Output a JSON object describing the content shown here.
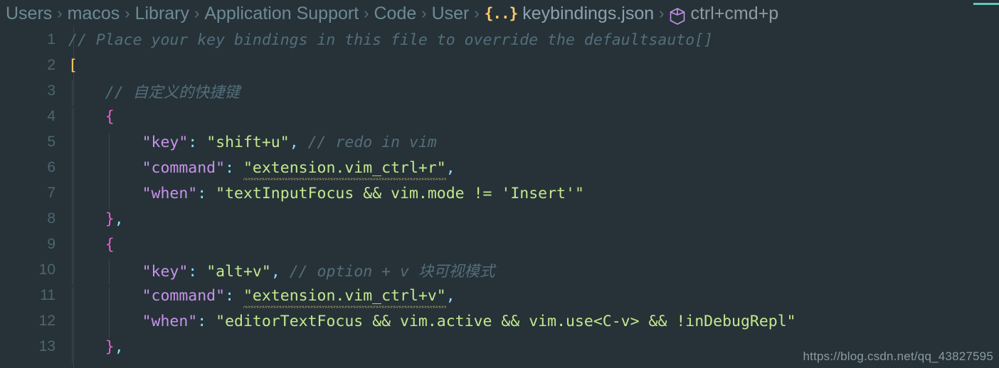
{
  "accent_color": "#5fc9bf",
  "breadcrumb": {
    "segments": [
      {
        "label": "Users",
        "type": "folder"
      },
      {
        "label": "macos",
        "type": "folder"
      },
      {
        "label": "Library",
        "type": "folder"
      },
      {
        "label": "Application Support",
        "type": "folder"
      },
      {
        "label": "Code",
        "type": "folder"
      },
      {
        "label": "User",
        "type": "folder"
      },
      {
        "label": "keybindings.json",
        "type": "file",
        "icon": "json-braces-icon",
        "icon_text": "{..}"
      },
      {
        "label": "ctrl+cmd+p",
        "type": "symbol",
        "icon": "symbol-cube-icon"
      }
    ],
    "separator": "›"
  },
  "editor": {
    "language": "jsonc",
    "file_name": "keybindings.json",
    "lines": [
      {
        "no": "1",
        "text": "// Place your key bindings in this file to override the defaultsauto[]"
      },
      {
        "no": "2",
        "text": "["
      },
      {
        "no": "3",
        "text": "    // 自定义的快捷键"
      },
      {
        "no": "4",
        "text": "    {"
      },
      {
        "no": "5",
        "text": "        \"key\": \"shift+u\", // redo in vim"
      },
      {
        "no": "6",
        "text": "        \"command\": \"extension.vim_ctrl+r\","
      },
      {
        "no": "7",
        "text": "        \"when\": \"textInputFocus && vim.mode != 'Insert'\""
      },
      {
        "no": "8",
        "text": "    },"
      },
      {
        "no": "9",
        "text": "    {"
      },
      {
        "no": "10",
        "text": "        \"key\": \"alt+v\", // option + v 块可视模式"
      },
      {
        "no": "11",
        "text": "        \"command\": \"extension.vim_ctrl+v\","
      },
      {
        "no": "12",
        "text": "        \"when\": \"editorTextFocus && vim.active && vim.use<C-v> && !inDebugRepl\""
      },
      {
        "no": "13",
        "text": "    },"
      }
    ],
    "tokens": {
      "line1_comment": "// Place your key bindings in this file to override the defaultsauto[]",
      "line2_bracket": "[",
      "line3_comment": "// 自定义的快捷键",
      "line4_brace": "{",
      "line5_key": "\"key\"",
      "line5_colon": ":",
      "line5_value": "\"shift+u\"",
      "line5_comma": ",",
      "line5_comment": "// redo in vim",
      "line6_key": "\"command\"",
      "line6_colon": ":",
      "line6_value": "\"extension.vim_ctrl+r\"",
      "line6_comma": ",",
      "line7_key": "\"when\"",
      "line7_colon": ":",
      "line7_value": "\"textInputFocus && vim.mode != 'Insert'\"",
      "line8_brace": "}",
      "line8_comma": ",",
      "line9_brace": "{",
      "line10_key": "\"key\"",
      "line10_colon": ":",
      "line10_value": "\"alt+v\"",
      "line10_comma": ",",
      "line10_comment": "// option + v 块可视模式",
      "line11_key": "\"command\"",
      "line11_colon": ":",
      "line11_value": "\"extension.vim_ctrl+v\"",
      "line11_comma": ",",
      "line12_key": "\"when\"",
      "line12_colon": ":",
      "line12_value": "\"editorTextFocus && vim.active && vim.use<C-v> && !inDebugRepl\"",
      "line13_brace": "}",
      "line13_comma": ","
    },
    "colors": {
      "background": "#263238",
      "comment": "#546e7a",
      "property_key": "#c792ea",
      "string": "#c3e88d",
      "punctuation": "#89ddff",
      "bracket_yellow": "#ffcb6b",
      "bracket_pink": "#ec5fd0",
      "line_number": "#4e6570",
      "warning_squiggle": "#d8b86a"
    }
  },
  "watermark": {
    "text": "https://blog.csdn.net/qq_43827595"
  }
}
